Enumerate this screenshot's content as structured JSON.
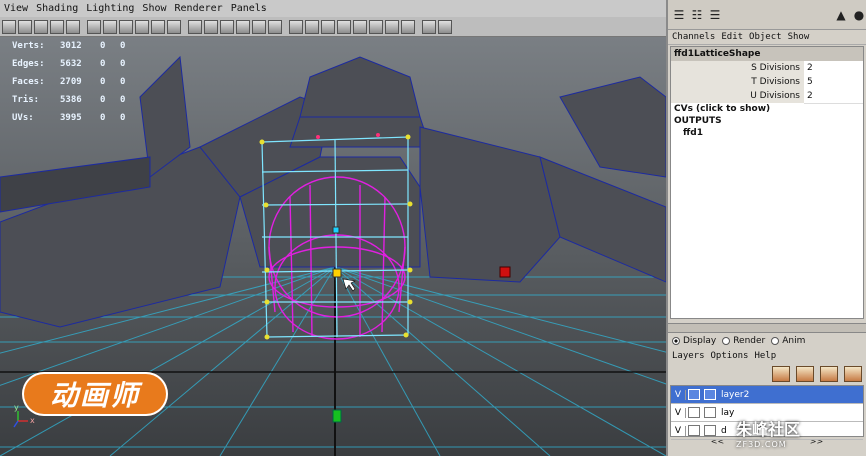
{
  "menubar": [
    "View",
    "Shading",
    "Lighting",
    "Show",
    "Renderer",
    "Panels"
  ],
  "stats": [
    {
      "label": "Verts:",
      "value": "3012",
      "a": "0",
      "b": "0"
    },
    {
      "label": "Edges:",
      "value": "5632",
      "a": "0",
      "b": "0"
    },
    {
      "label": "Faces:",
      "value": "2709",
      "a": "0",
      "b": "0"
    },
    {
      "label": "Tris:",
      "value": "5386",
      "a": "0",
      "b": "0"
    },
    {
      "label": "UVs:",
      "value": "3995",
      "a": "0",
      "b": "0"
    }
  ],
  "logo_text": "动画师",
  "axis": {
    "y": "y",
    "x": "x"
  },
  "channel_menu": [
    "Channels",
    "Edit",
    "Object",
    "Show"
  ],
  "node_name": "ffd1LatticeShape",
  "attributes": [
    {
      "name": "S Divisions",
      "value": "2"
    },
    {
      "name": "T Divisions",
      "value": "5"
    },
    {
      "name": "U Divisions",
      "value": "2"
    }
  ],
  "cvs_label": "CVs (click to show)",
  "outputs_label": "OUTPUTS",
  "output_item": "ffd1",
  "radios": [
    {
      "label": "Display",
      "on": true
    },
    {
      "label": "Render",
      "on": false
    },
    {
      "label": "Anim",
      "on": false
    }
  ],
  "layer_menu": [
    "Layers",
    "Options",
    "Help"
  ],
  "layers": [
    {
      "v": "V",
      "name": "layer2",
      "selected": true
    },
    {
      "v": "V",
      "name": "lay",
      "selected": false
    },
    {
      "v": "V",
      "name": "d",
      "selected": false
    }
  ],
  "scroll": {
    "left": "<<",
    "right": ">>"
  },
  "watermark": {
    "title": "朱峰社区",
    "sub": "ZF3D.COM"
  }
}
